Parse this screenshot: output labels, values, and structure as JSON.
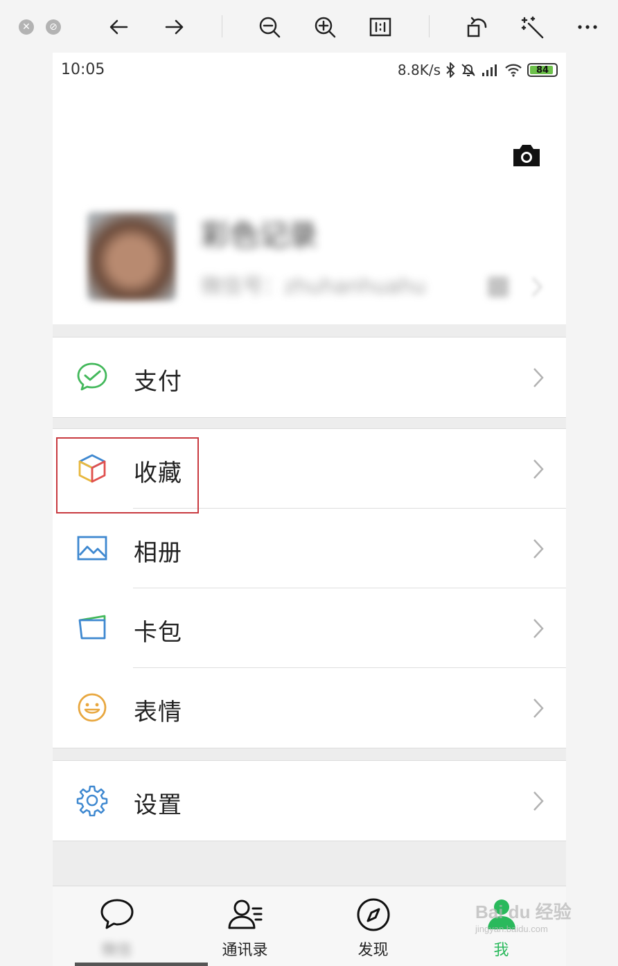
{
  "icons": {
    "viewer_close": "close-icon",
    "viewer_minimize": "minimize-icon",
    "back": "arrow-left-icon",
    "forward": "arrow-right-icon",
    "zoom_out": "zoom-out-icon",
    "zoom_in": "zoom-in-icon",
    "actual_size": "actual-size-icon",
    "rotate": "rotate-icon",
    "magic": "magic-wand-icon",
    "more": "more-icon"
  },
  "status_bar": {
    "time": "10:05",
    "speed": "8.8K/s",
    "battery": "84"
  },
  "profile": {
    "name": "彩色记录",
    "id": "微信号：zhuhanhuahu"
  },
  "menu": {
    "pay": "支付",
    "favorites": "收藏",
    "album": "相册",
    "cards": "卡包",
    "stickers": "表情",
    "settings": "设置"
  },
  "tab_bar": {
    "chats": "微信",
    "contacts": "通讯录",
    "discover": "发现",
    "me": "我"
  },
  "watermark": {
    "brand": "Bai du 经验",
    "url": "jingyan.baidu.com"
  },
  "colors": {
    "accent_green": "#2ab95c",
    "highlight_red": "#c8393f",
    "pay_green": "#43b85b",
    "icon_blue": "#3e88d0",
    "sticker_orange": "#e8a73f"
  }
}
